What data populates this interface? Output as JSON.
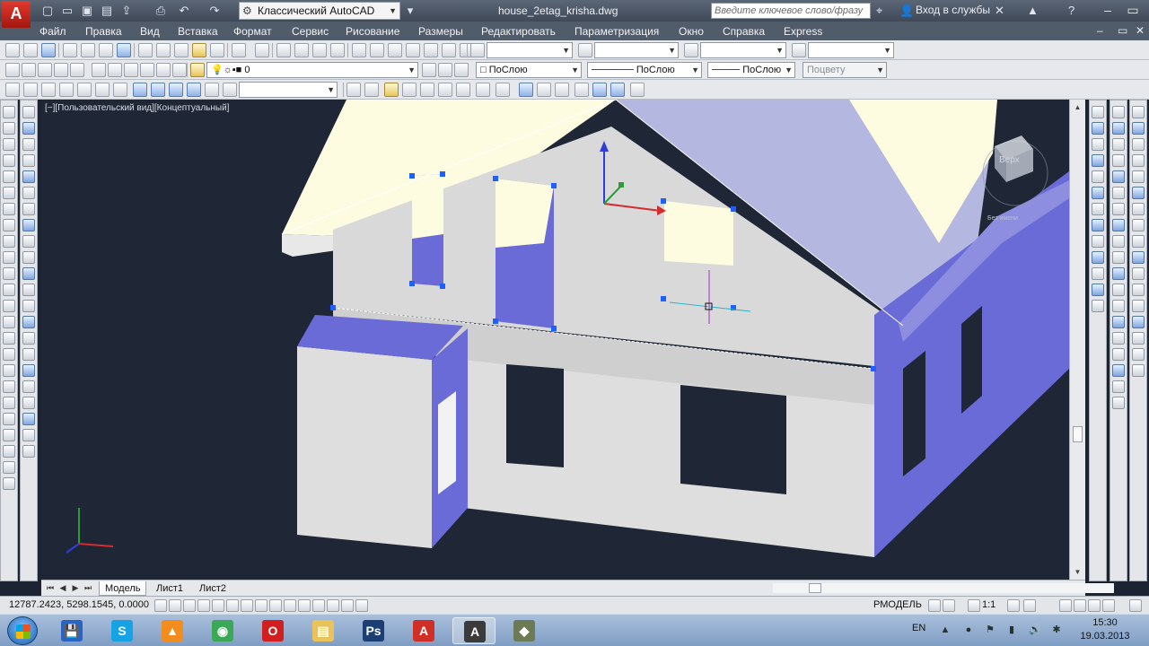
{
  "app": {
    "logo_letter": "A",
    "workspace": "Классический AutoCAD",
    "document_title": "house_2etag_krisha.dwg",
    "search_placeholder": "Введите ключевое слово/фразу",
    "sign_in": "Вход в службы"
  },
  "menu": [
    "Файл",
    "Правка",
    "Вид",
    "Вставка",
    "Формат",
    "Сервис",
    "Рисование",
    "Размеры",
    "Редактировать",
    "Параметризация",
    "Окно",
    "Справка",
    "Express"
  ],
  "properties": {
    "layer": "0",
    "color": "ПоСлою",
    "linetype": "ПоСлою",
    "lineweight": "ПоСлою",
    "plotstyle": "Поцвету"
  },
  "viewport": {
    "label": "[−][Пользовательский вид][Концептуальный]",
    "viewcube_face": "Верх",
    "wcs_label": "Без имени"
  },
  "layout_tabs": [
    "Модель",
    "Лист1",
    "Лист2"
  ],
  "status": {
    "coordinates": "12787.2423, 5298.1545, 0.0000",
    "model_label": "РМОДЕЛЬ",
    "scale": "1:1"
  },
  "taskbar": {
    "apps": [
      {
        "name": "save-disk",
        "color": "#2a63c2",
        "glyph": "💾"
      },
      {
        "name": "skype",
        "color": "#16a3e3",
        "glyph": "S"
      },
      {
        "name": "avast",
        "color": "#f28d1d",
        "glyph": "▲"
      },
      {
        "name": "chrome",
        "color": "#3aa857",
        "glyph": "◉"
      },
      {
        "name": "opera",
        "color": "#d11e1e",
        "glyph": "O"
      },
      {
        "name": "explorer",
        "color": "#e9c35a",
        "glyph": "▤"
      },
      {
        "name": "photoshop",
        "color": "#1b3f73",
        "glyph": "Ps"
      },
      {
        "name": "acrobat",
        "color": "#d02f26",
        "glyph": "A"
      },
      {
        "name": "autocad",
        "color": "#3b3b3b",
        "glyph": "A"
      },
      {
        "name": "autocad-tool",
        "color": "#6c7a55",
        "glyph": "◆"
      }
    ],
    "language": "EN",
    "time": "15:30",
    "date": "19.03.2013"
  },
  "colors": {
    "viewport_bg": "#1f2736",
    "wall": "#d9d9d9",
    "wall_side": "#6b6bd8",
    "roof": "#fdfbe0",
    "roof_shade": "#b4b7df",
    "grip": "#1f5fff"
  }
}
